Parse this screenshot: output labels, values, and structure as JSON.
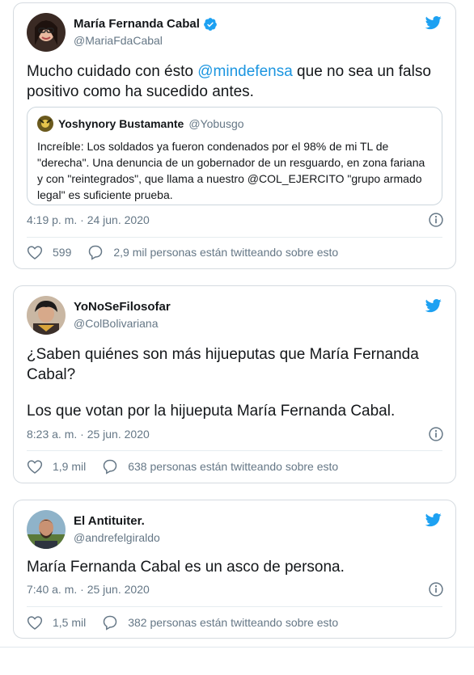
{
  "colors": {
    "accent": "#1da1f2",
    "mention": "#1b95e0",
    "muted": "#657786"
  },
  "tweets": [
    {
      "name": "María Fernanda Cabal",
      "handle": "@MariaFdaCabal",
      "verified": true,
      "text_line1_pre": "Mucho cuidado con ésto ",
      "text_mention": "@mindefensa",
      "text_line1_post": " que no sea un falso",
      "text_line2": "positivo como ha sucedido antes.",
      "quote": {
        "name": "Yoshynory Bustamante",
        "handle": "@Yobusgo",
        "text": "Increíble: Los soldados ya fueron condenados por el 98% de mi TL de \"derecha\". Una denuncia de un gobernador de un resguardo, en zona fariana y con \"reintegrados\", que llama a nuestro @COL_EJERCITO \"grupo armado legal\" es suficiente prueba."
      },
      "time": "4:19 p. m. · 24 jun. 2020",
      "likes": "599",
      "replies": "2,9 mil personas están twitteando sobre esto"
    },
    {
      "name": "YoNoSeFilosofar",
      "handle": "@ColBolivariana",
      "verified": false,
      "text_line1": "¿Saben quiénes son más hijueputas que María Fernanda",
      "text_line2": "Cabal?",
      "text_line3": "Los que votan por la hijueputa María Fernanda Cabal.",
      "time": "8:23 a. m. · 25 jun. 2020",
      "likes": "1,9 mil",
      "replies": "638 personas están twitteando sobre esto"
    },
    {
      "name": "El Antituiter.",
      "handle": "@andrefelgiraldo",
      "verified": false,
      "text_line1": "María Fernanda Cabal es un asco de persona.",
      "time": "7:40 a. m. · 25 jun. 2020",
      "likes": "1,5 mil",
      "replies": "382 personas están twitteando sobre esto"
    }
  ]
}
